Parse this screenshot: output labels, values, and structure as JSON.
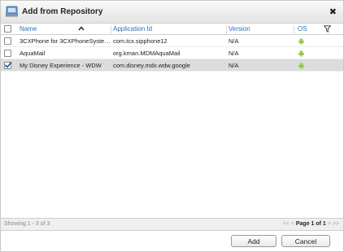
{
  "dialog": {
    "title": "Add from Repository",
    "close_symbol": "✖"
  },
  "grid": {
    "columns": {
      "name": "Name",
      "app_id": "Application Id",
      "version": "Version",
      "os": "OS"
    },
    "rows": [
      {
        "name": "3CXPhone for 3CXPhoneSyste…",
        "app_id": "com.tcx.sipphone12",
        "version": "N/A",
        "os_icon": "android-icon",
        "checked": false
      },
      {
        "name": "AquaMail",
        "app_id": "org.kman.MDMAquaMail",
        "version": "N/A",
        "os_icon": "android-icon",
        "checked": false
      },
      {
        "name": "My Disney Experience - WDW",
        "app_id": "com.disney.mdx.wdw.google",
        "version": "N/A",
        "os_icon": "android-icon",
        "checked": true
      }
    ]
  },
  "footer": {
    "showing": "Showing 1 - 3 of 3",
    "pager_prev": "<< <",
    "pager_page": "Page 1 of 1",
    "pager_next": "> >>"
  },
  "buttons": {
    "add": "Add",
    "cancel": "Cancel"
  },
  "colors": {
    "header_link": "#2f6fb5",
    "android_green": "#8cc33f",
    "selected_row": "#dcdcdc"
  }
}
